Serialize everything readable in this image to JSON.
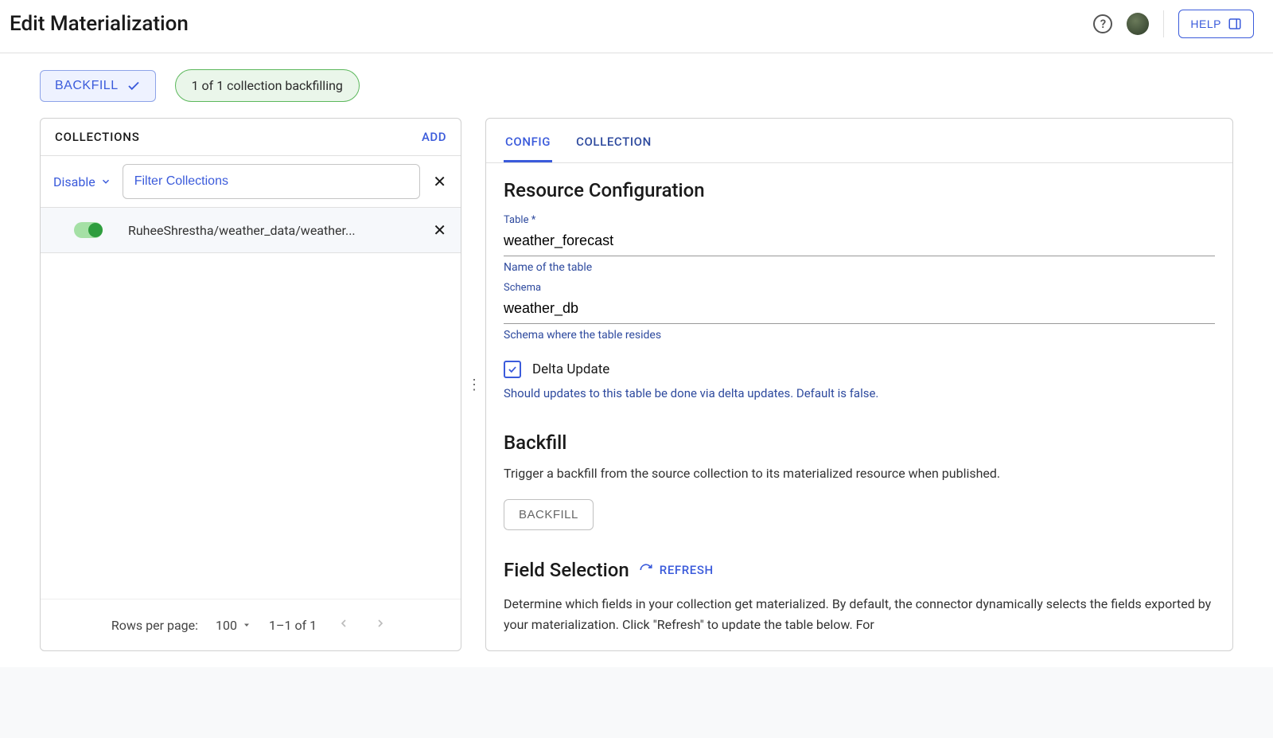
{
  "header": {
    "title": "Edit Materialization",
    "help_button": "HELP"
  },
  "toolbar": {
    "backfill_button": "BACKFILL",
    "status_badge": "1 of 1 collection backfilling"
  },
  "left_panel": {
    "title": "COLLECTIONS",
    "add_link": "ADD",
    "disable_label": "Disable",
    "filter_placeholder": "Filter Collections",
    "rows": [
      {
        "name": "RuheeShrestha/weather_data/weather...",
        "enabled": true
      }
    ],
    "pagination": {
      "rows_label": "Rows per page:",
      "page_size": "100",
      "range": "1–1 of 1"
    }
  },
  "right_panel": {
    "tabs": {
      "config": "CONFIG",
      "collection": "COLLECTION"
    },
    "resource_config": {
      "heading": "Resource Configuration",
      "table_label": "Table",
      "table_value": "weather_forecast",
      "table_help": "Name of the table",
      "schema_label": "Schema",
      "schema_value": "weather_db",
      "schema_help": "Schema where the table resides",
      "delta_label": "Delta Update",
      "delta_help": "Should updates to this table be done via delta updates. Default is false."
    },
    "backfill_section": {
      "heading": "Backfill",
      "text": "Trigger a backfill from the source collection to its materialized resource when published.",
      "button": "BACKFILL"
    },
    "field_selection": {
      "heading": "Field Selection",
      "refresh": "REFRESH",
      "text": "Determine which fields in your collection get materialized. By default, the connector dynamically selects the fields exported by your materialization. Click \"Refresh\" to update the table below. For"
    }
  }
}
